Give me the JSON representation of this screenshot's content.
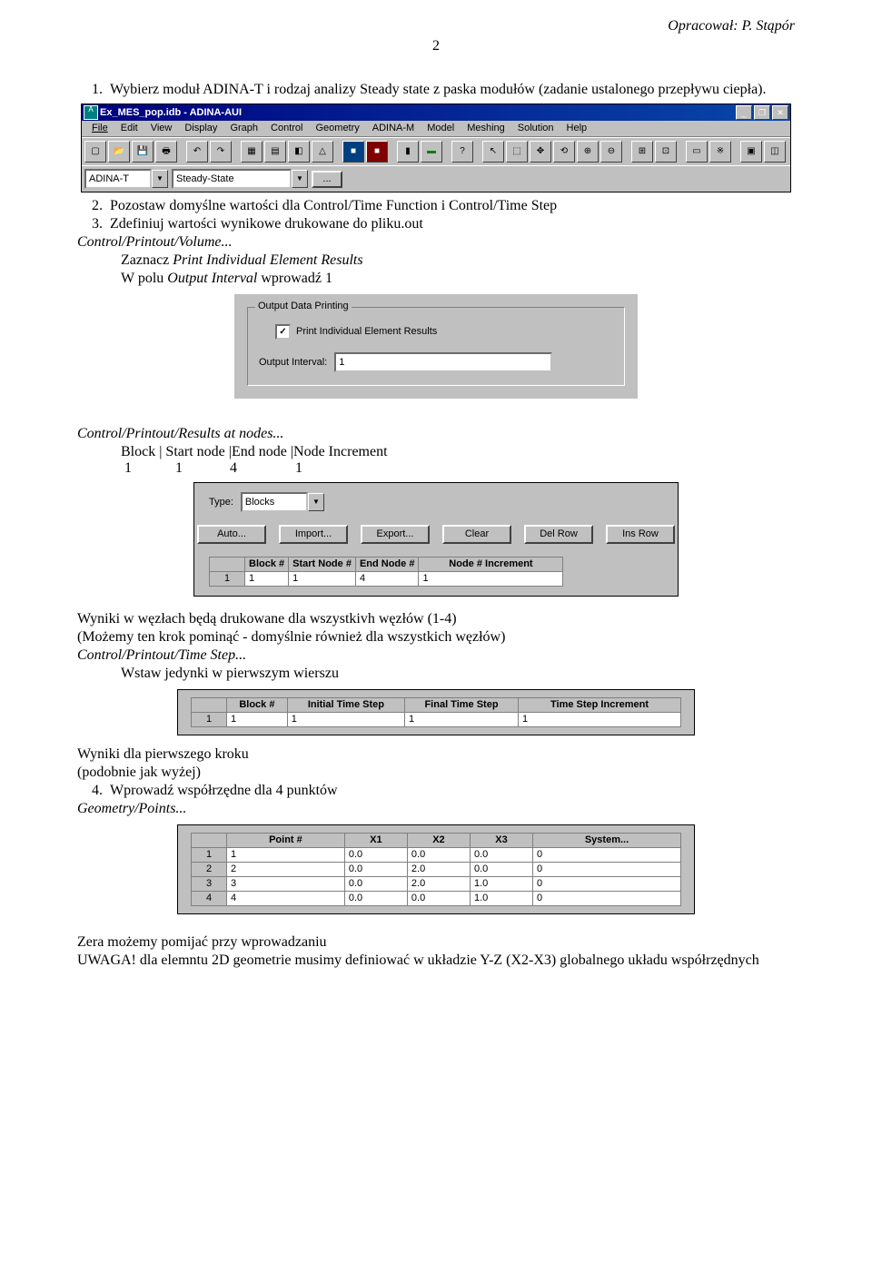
{
  "header": {
    "author": "Opracował:  P. Stąpór",
    "page": "2"
  },
  "text": {
    "li1": "Wybierz moduł ADINA-T i rodzaj analizy Steady state z paska modułów (zadanie ustalonego przepływu ciepła).",
    "li2": "Pozostaw domyślne wartości dla Control/Time Function i Control/Time Step",
    "li3a": "Zdefiniuj wartości wynikowe drukowane do pliku.out",
    "li3b": "Control/Printout/Volume...",
    "li3c": "Zaznacz Print Individual Element Results",
    "li3d": "W polu Output Interval  wprowadź 1",
    "p4": "Control/Printout/Results at nodes...",
    "p5": "Block | Start node |End node |Node Increment",
    "p6": " 1            1             4                1",
    "p7": "Wyniki w węzłach będą drukowane dla wszystkivh węzłów (1-4)",
    "p8": "(Możemy ten krok pominąć - domyślnie również dla wszystkich węzłów)",
    "p9": "Control/Printout/Time Step...",
    "p10": "Wstaw jedynki w pierwszym wierszu",
    "p11": "Wyniki dla pierwszego kroku",
    "p12": "(podobnie jak wyżej)",
    "li4": "Wprowadź współrzędne dla 4 punktów",
    "p13": "Geometry/Points...",
    "p14": "Zera możemy pomijać przy wprowadzaniu",
    "p15": "UWAGA! dla elemntu 2D geometrie musimy definiować w układzie Y-Z (X2-X3) globalnego układu współrzędnych"
  },
  "mainwin": {
    "title": "Ex_MES_pop.idb - ADINA-AUI",
    "menus": [
      "File",
      "Edit",
      "View",
      "Display",
      "Graph",
      "Control",
      "Geometry",
      "ADINA-M",
      "Model",
      "Meshing",
      "Solution",
      "Help"
    ],
    "combo1": "ADINA-T",
    "combo2": "Steady-State",
    "dots": "..."
  },
  "outputbox": {
    "legend": "Output Data Printing",
    "chk": "Print Individual Element Results",
    "label": "Output Interval:",
    "value": "1"
  },
  "blocks": {
    "typelabel": "Type:",
    "typevalue": "Blocks",
    "btns": [
      "Auto...",
      "Import...",
      "Export...",
      "Clear",
      "Del Row",
      "Ins Row"
    ],
    "cols": [
      "Block #",
      "Start Node #",
      "End Node #",
      "Node # Increment"
    ],
    "row": [
      "1",
      "1",
      "1",
      "4",
      "1"
    ]
  },
  "timestep": {
    "cols": [
      "Block #",
      "Initial Time Step",
      "Final Time Step",
      "Time Step Increment"
    ],
    "row": [
      "1",
      "1",
      "1",
      "1",
      "1"
    ]
  },
  "points": {
    "cols": [
      "Point #",
      "X1",
      "X2",
      "X3",
      "System..."
    ],
    "rows": [
      [
        "1",
        "1",
        "0.0",
        "0.0",
        "0.0",
        "0"
      ],
      [
        "2",
        "2",
        "0.0",
        "2.0",
        "0.0",
        "0"
      ],
      [
        "3",
        "3",
        "0.0",
        "2.0",
        "1.0",
        "0"
      ],
      [
        "4",
        "4",
        "0.0",
        "0.0",
        "1.0",
        "0"
      ]
    ]
  }
}
